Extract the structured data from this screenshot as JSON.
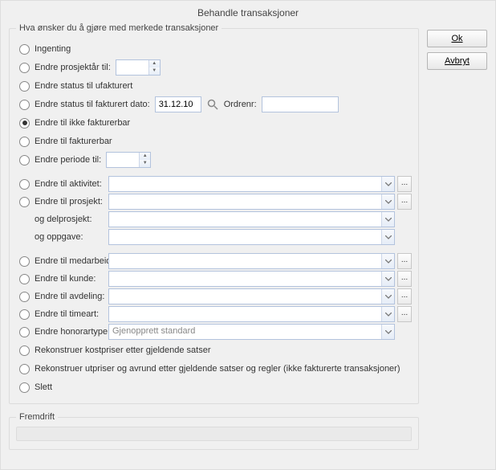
{
  "window": {
    "title": "Behandle transaksjoner"
  },
  "buttons": {
    "ok": "Ok",
    "cancel": "Avbryt"
  },
  "group": {
    "legend": "Hva ønsker du å gjøre med merkede transaksjoner",
    "options": {
      "ingenting": "Ingenting",
      "endre_prosjektar": "Endre prosjektår til:",
      "endre_status_ufakturert": "Endre status til ufakturert",
      "endre_status_fakturert_dato": "Endre status til fakturert dato:",
      "ordrenr_label": "Ordrenr:",
      "endre_ikke_fakturerbar": "Endre til ikke fakturerbar",
      "endre_fakturerbar": "Endre til fakturerbar",
      "endre_periode_til": "Endre periode til:",
      "endre_aktivitet": "Endre til aktivitet:",
      "endre_prosjekt": "Endre til prosjekt:",
      "og_delprosjekt": "og delprosjekt:",
      "og_oppgave": "og oppgave:",
      "endre_medarbeider": "Endre til medarbeider:",
      "endre_kunde": "Endre til kunde:",
      "endre_avdeling": "Endre til avdeling:",
      "endre_timeart": "Endre til timeart:",
      "endre_honorartype": "Endre honorartype:",
      "rekonstruer_kostpriser": "Rekonstruer kostpriser etter gjeldende satser",
      "rekonstruer_utpriser": "Rekonstruer utpriser og avrund etter gjeldende satser og regler (ikke fakturerte transaksjoner)",
      "slett": "Slett"
    },
    "selected": "endre_ikke_fakturerbar",
    "values": {
      "prosjektar": "",
      "fakturert_dato": "31.12.10",
      "ordrenr": "",
      "periode": "",
      "aktivitet": "",
      "prosjekt": "",
      "delprosjekt": "",
      "oppgave": "",
      "medarbeider": "",
      "kunde": "",
      "avdeling": "",
      "timeart": "",
      "honorartype": "Gjenopprett standard"
    }
  },
  "progress": {
    "legend": "Fremdrift",
    "value": 0
  },
  "glyphs": {
    "ellipsis": "...",
    "up": "▲",
    "down": "▼"
  }
}
